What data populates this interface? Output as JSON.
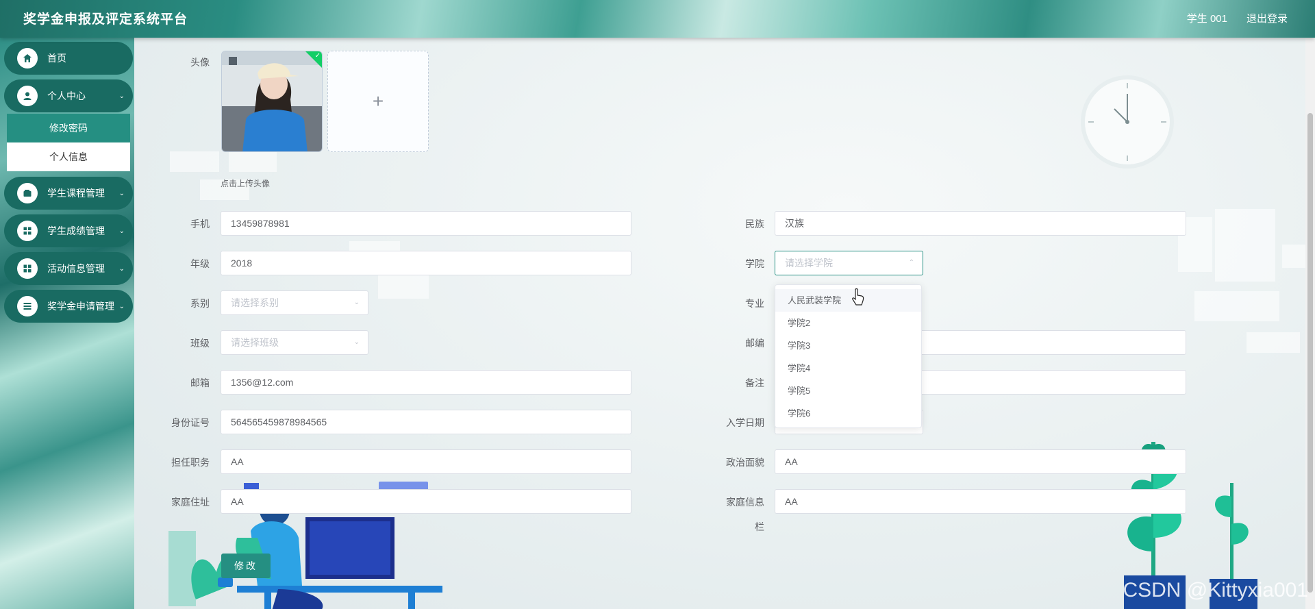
{
  "header": {
    "title": "奖学金申报及评定系统平台",
    "user": "学生 001",
    "logout": "退出登录"
  },
  "sidebar": {
    "items": [
      {
        "label": "首页",
        "icon": "home-icon"
      },
      {
        "label": "个人中心",
        "icon": "user-icon"
      },
      {
        "label": "学生课程管理",
        "icon": "wallet-icon"
      },
      {
        "label": "学生成绩管理",
        "icon": "grid-icon"
      },
      {
        "label": "活动信息管理",
        "icon": "grid-icon"
      },
      {
        "label": "奖学金申请管理",
        "icon": "list-icon"
      }
    ],
    "subitems": [
      "修改密码",
      "个人信息"
    ]
  },
  "form": {
    "avatar_label": "头像",
    "upload_hint": "点击上传头像",
    "phone_label": "手机",
    "phone_value": "13459878981",
    "grade_label": "年级",
    "grade_value": "2018",
    "dept_label": "系别",
    "dept_placeholder": "请选择系别",
    "class_label": "班级",
    "class_placeholder": "请选择班级",
    "email_label": "邮箱",
    "email_value": "1356@12.com",
    "id_label": "身份证号",
    "id_value": "564565459878984565",
    "position_label": "担任职务",
    "position_value": "AA",
    "address_label": "家庭住址",
    "address_value": "AA",
    "ethnic_label": "民族",
    "ethnic_value": "汉族",
    "college_label": "学院",
    "college_placeholder": "请选择学院",
    "major_label": "专业",
    "postcode_label": "邮编",
    "remark_label": "备注",
    "enroll_label": "入学日期",
    "political_label": "政治面貌",
    "political_value": "AA",
    "family_label_1": "家庭信息",
    "family_label_2": "栏",
    "family_value": "AA",
    "submit": "修改"
  },
  "dropdown": {
    "options": [
      "人民武装学院",
      "学院2",
      "学院3",
      "学院4",
      "学院5",
      "学院6"
    ]
  },
  "overlay": {
    "watermark": "CSDN @Kittyxia001"
  },
  "colors": {
    "accent": "#258f82",
    "menu_bg": "#196b62"
  }
}
